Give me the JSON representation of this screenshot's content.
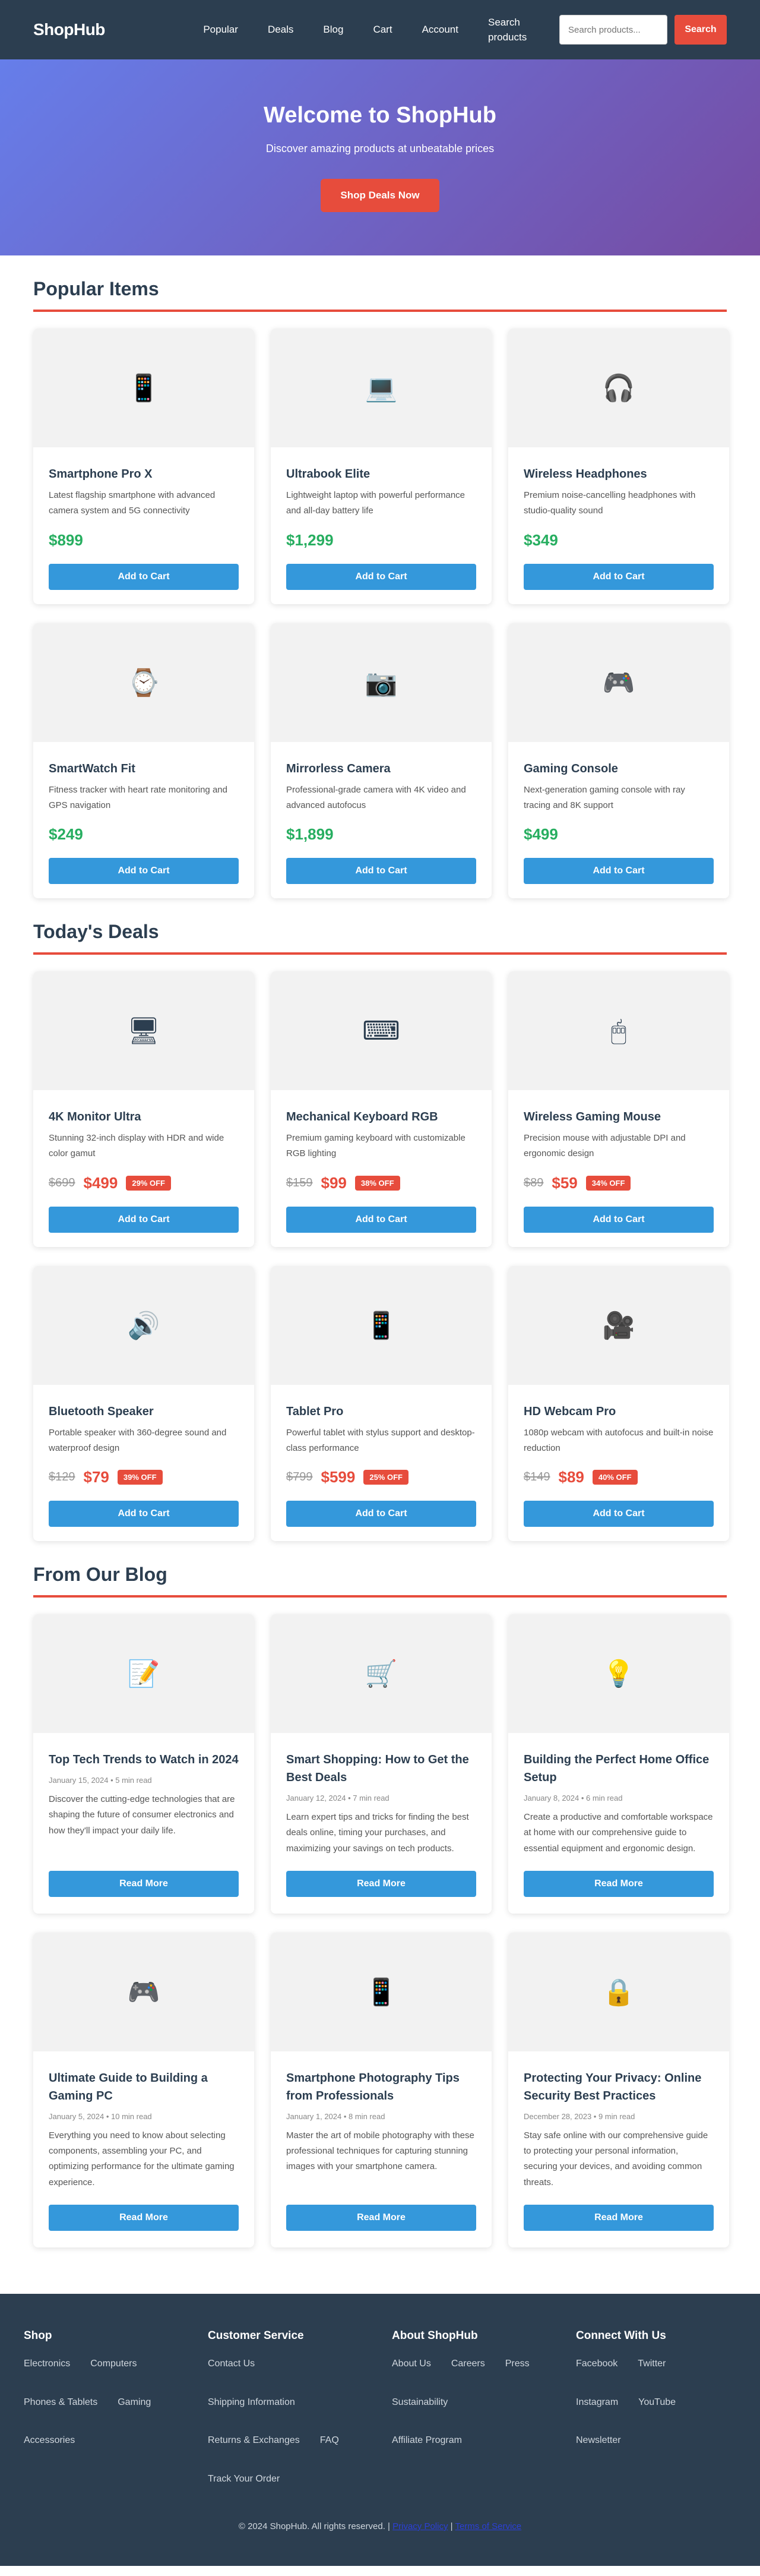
{
  "header": {
    "logo": "ShopHub",
    "nav": [
      "Popular",
      "Deals",
      "Blog",
      "Cart",
      "Account",
      "Search products"
    ],
    "search_placeholder": "Search products...",
    "search_button": "Search"
  },
  "hero": {
    "title": "Welcome to ShopHub",
    "subtitle": "Discover amazing products at unbeatable prices",
    "cta": "Shop Deals Now"
  },
  "popular": {
    "title": "Popular Items",
    "button": "Add to Cart",
    "items": [
      {
        "icon": "📱",
        "icon_name": "smartphone-icon",
        "name": "Smartphone Pro X",
        "desc": "Latest flagship smartphone with advanced camera system and 5G connectivity",
        "price": "$899"
      },
      {
        "icon": "💻",
        "icon_name": "laptop-icon",
        "name": "Ultrabook Elite",
        "desc": "Lightweight laptop with powerful performance and all-day battery life",
        "price": "$1,299"
      },
      {
        "icon": "🎧",
        "icon_name": "headphones-icon",
        "name": "Wireless Headphones",
        "desc": "Premium noise-cancelling headphones with studio-quality sound",
        "price": "$349"
      },
      {
        "icon": "⌚",
        "icon_name": "smartwatch-icon",
        "name": "SmartWatch Fit",
        "desc": "Fitness tracker with heart rate monitoring and GPS navigation",
        "price": "$249"
      },
      {
        "icon": "📷",
        "icon_name": "camera-icon",
        "name": "Mirrorless Camera",
        "desc": "Professional-grade camera with 4K video and advanced autofocus",
        "price": "$1,899"
      },
      {
        "icon": "🎮",
        "icon_name": "gamepad-icon",
        "name": "Gaming Console",
        "desc": "Next-generation gaming console with ray tracing and 8K support",
        "price": "$499"
      }
    ]
  },
  "deals": {
    "title": "Today's Deals",
    "button": "Add to Cart",
    "items": [
      {
        "icon": "🖥",
        "icon_name": "monitor-icon",
        "name": "4K Monitor Ultra",
        "desc": "Stunning 32-inch display with HDR and wide color gamut",
        "old_price": "$699",
        "price": "$499",
        "badge": "29% OFF"
      },
      {
        "icon": "⌨",
        "icon_name": "keyboard-icon",
        "name": "Mechanical Keyboard RGB",
        "desc": "Premium gaming keyboard with customizable RGB lighting",
        "old_price": "$159",
        "price": "$99",
        "badge": "38% OFF"
      },
      {
        "icon": "🖱",
        "icon_name": "mouse-icon",
        "name": "Wireless Gaming Mouse",
        "desc": "Precision mouse with adjustable DPI and ergonomic design",
        "old_price": "$89",
        "price": "$59",
        "badge": "34% OFF"
      },
      {
        "icon": "🔊",
        "icon_name": "speaker-icon",
        "name": "Bluetooth Speaker",
        "desc": "Portable speaker with 360-degree sound and waterproof design",
        "old_price": "$129",
        "price": "$79",
        "badge": "39% OFF"
      },
      {
        "icon": "📱",
        "icon_name": "tablet-icon",
        "name": "Tablet Pro",
        "desc": "Powerful tablet with stylus support and desktop-class performance",
        "old_price": "$799",
        "price": "$599",
        "badge": "25% OFF"
      },
      {
        "icon": "🎥",
        "icon_name": "webcam-icon",
        "name": "HD Webcam Pro",
        "desc": "1080p webcam with autofocus and built-in noise reduction",
        "old_price": "$149",
        "price": "$89",
        "badge": "40% OFF"
      }
    ]
  },
  "blog": {
    "title": "From Our Blog",
    "button": "Read More",
    "posts": [
      {
        "icon": "📝",
        "icon_name": "memo-icon",
        "title": "Top Tech Trends to Watch in 2024",
        "meta": "January 15, 2024 • 5 min read",
        "excerpt": "Discover the cutting-edge technologies that are shaping the future of consumer electronics and how they'll impact your daily life."
      },
      {
        "icon": "🛒",
        "icon_name": "shopping-cart-icon",
        "title": "Smart Shopping: How to Get the Best Deals",
        "meta": "January 12, 2024 • 7 min read",
        "excerpt": "Learn expert tips and tricks for finding the best deals online, timing your purchases, and maximizing your savings on tech products."
      },
      {
        "icon": "💡",
        "icon_name": "lightbulb-icon",
        "title": "Building the Perfect Home Office Setup",
        "meta": "January 8, 2024 • 6 min read",
        "excerpt": "Create a productive and comfortable workspace at home with our comprehensive guide to essential equipment and ergonomic design."
      },
      {
        "icon": "🎮",
        "icon_name": "gamepad-icon",
        "title": "Ultimate Guide to Building a Gaming PC",
        "meta": "January 5, 2024 • 10 min read",
        "excerpt": "Everything you need to know about selecting components, assembling your PC, and optimizing performance for the ultimate gaming experience."
      },
      {
        "icon": "📱",
        "icon_name": "smartphone-icon",
        "title": "Smartphone Photography Tips from Professionals",
        "meta": "January 1, 2024 • 8 min read",
        "excerpt": "Master the art of mobile photography with these professional techniques for capturing stunning images with your smartphone camera."
      },
      {
        "icon": "🔒",
        "icon_name": "lock-icon",
        "title": "Protecting Your Privacy: Online Security Best Practices",
        "meta": "December 28, 2023 • 9 min read",
        "excerpt": "Stay safe online with our comprehensive guide to protecting your personal information, securing your devices, and avoiding common threats."
      }
    ]
  },
  "footer": {
    "columns": [
      {
        "title": "Shop",
        "links": [
          "Electronics",
          "Computers",
          "Phones & Tablets",
          "Gaming",
          "Accessories"
        ]
      },
      {
        "title": "Customer Service",
        "links": [
          "Contact Us",
          "Shipping Information",
          "Returns & Exchanges",
          "FAQ",
          "Track Your Order"
        ]
      },
      {
        "title": "About ShopHub",
        "links": [
          "About Us",
          "Careers",
          "Press",
          "Sustainability",
          "Affiliate Program"
        ]
      },
      {
        "title": "Connect With Us",
        "links": [
          "Facebook",
          "Twitter",
          "Instagram",
          "YouTube",
          "Newsletter"
        ]
      }
    ],
    "copyright": "© 2024 ShopHub. All rights reserved. |",
    "privacy": "Privacy Policy",
    "separator": "|",
    "terms": "Terms of Service"
  },
  "colors": {
    "header_bg": "#2c3e50",
    "accent_red": "#e74c3c",
    "button_blue": "#3498db",
    "price_green": "#27ae60",
    "hero_gradient": [
      "#667eea",
      "#764ba2"
    ]
  }
}
